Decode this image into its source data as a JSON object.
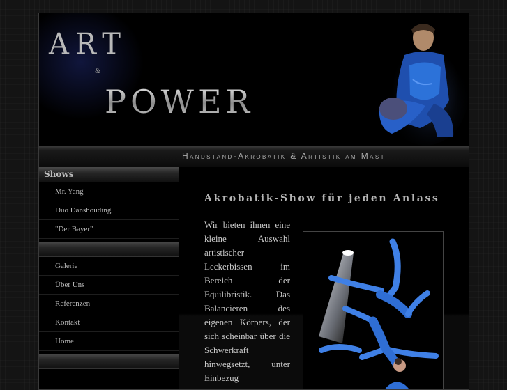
{
  "banner": {
    "logo_line1": "ART",
    "logo_amp": "&",
    "logo_line2": "POWER",
    "subtitle": "Handstand-Akrobatik & Artistik am Mast"
  },
  "sidebar": {
    "section_title": "Shows",
    "shows": [
      {
        "label": "Mr. Yang"
      },
      {
        "label": "Duo Danshouding"
      },
      {
        "label": "\"Der Bayer\""
      }
    ],
    "nav": [
      {
        "label": "Galerie"
      },
      {
        "label": "Über Uns"
      },
      {
        "label": "Referenzen"
      },
      {
        "label": "Kontakt"
      },
      {
        "label": "Home"
      }
    ]
  },
  "main": {
    "title": "Akrobatik-Show für jeden Anlass",
    "body": "Wir bieten ihnen eine kleine Auswahl artistischer Leckerbissen im Bereich der Equilibristik. Das Balancieren des eigenen Körpers, der sich scheinbar über die Schwerkraft hinwegsetzt, unter Einbezug"
  },
  "colors": {
    "background": "#141414",
    "frame": "#000000",
    "text": "#c8c8c8",
    "accent_blue": "#2a6fd6"
  }
}
